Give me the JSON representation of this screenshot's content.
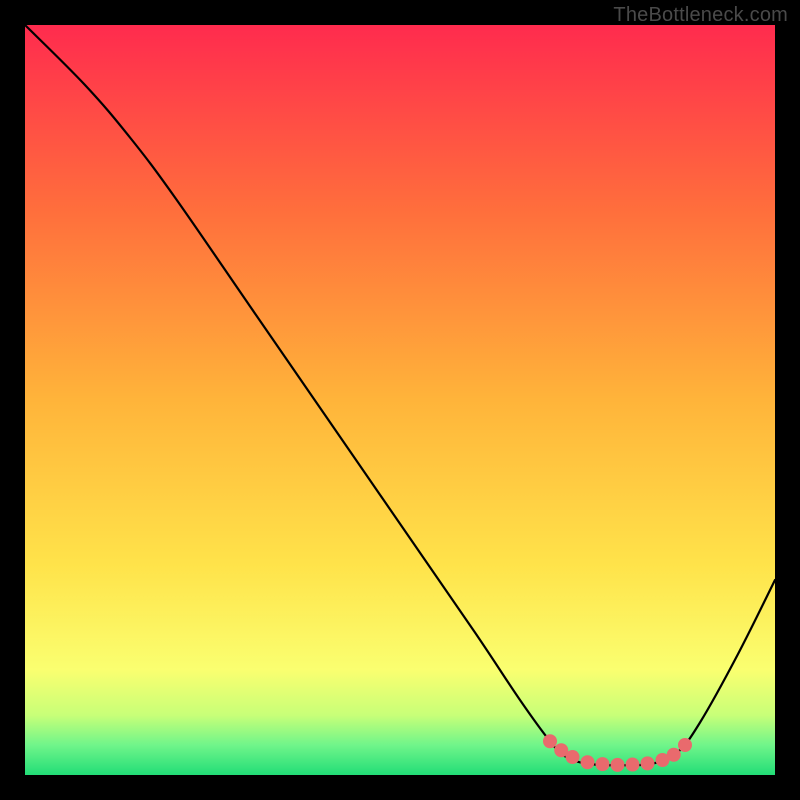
{
  "watermark": "TheBottleneck.com",
  "chart_data": {
    "type": "line",
    "title": "",
    "xlabel": "",
    "ylabel": "",
    "xlim": [
      0,
      100
    ],
    "ylim": [
      0,
      100
    ],
    "grid": false,
    "background_gradient_stops": [
      {
        "offset": 0,
        "color": "#ff2b4e"
      },
      {
        "offset": 25,
        "color": "#ff6f3c"
      },
      {
        "offset": 50,
        "color": "#ffb43a"
      },
      {
        "offset": 72,
        "color": "#ffe34a"
      },
      {
        "offset": 86,
        "color": "#faff70"
      },
      {
        "offset": 92,
        "color": "#c8ff78"
      },
      {
        "offset": 96,
        "color": "#70f58a"
      },
      {
        "offset": 100,
        "color": "#22dd77"
      }
    ],
    "series": [
      {
        "name": "bottleneck-curve",
        "color": "#000000",
        "stroke_width": 2.2,
        "points": [
          {
            "x": 0,
            "y": 100
          },
          {
            "x": 8,
            "y": 92
          },
          {
            "x": 14,
            "y": 85
          },
          {
            "x": 20,
            "y": 77
          },
          {
            "x": 30,
            "y": 62.5
          },
          {
            "x": 40,
            "y": 48
          },
          {
            "x": 50,
            "y": 33.5
          },
          {
            "x": 60,
            "y": 19
          },
          {
            "x": 66,
            "y": 10
          },
          {
            "x": 70,
            "y": 4.5
          },
          {
            "x": 72,
            "y": 2.5
          },
          {
            "x": 75,
            "y": 1.5
          },
          {
            "x": 80,
            "y": 1.3
          },
          {
            "x": 84,
            "y": 1.6
          },
          {
            "x": 87,
            "y": 3
          },
          {
            "x": 90,
            "y": 7
          },
          {
            "x": 95,
            "y": 16
          },
          {
            "x": 100,
            "y": 26
          }
        ]
      }
    ],
    "markers": {
      "name": "highlight-dots",
      "color": "#e96a6d",
      "radius": 7,
      "points": [
        {
          "x": 70,
          "y": 4.5
        },
        {
          "x": 71.5,
          "y": 3.3
        },
        {
          "x": 73,
          "y": 2.4
        },
        {
          "x": 75,
          "y": 1.7
        },
        {
          "x": 77,
          "y": 1.45
        },
        {
          "x": 79,
          "y": 1.35
        },
        {
          "x": 81,
          "y": 1.4
        },
        {
          "x": 83,
          "y": 1.55
        },
        {
          "x": 85,
          "y": 2.0
        },
        {
          "x": 86.5,
          "y": 2.7
        },
        {
          "x": 88,
          "y": 4.0
        }
      ]
    }
  }
}
